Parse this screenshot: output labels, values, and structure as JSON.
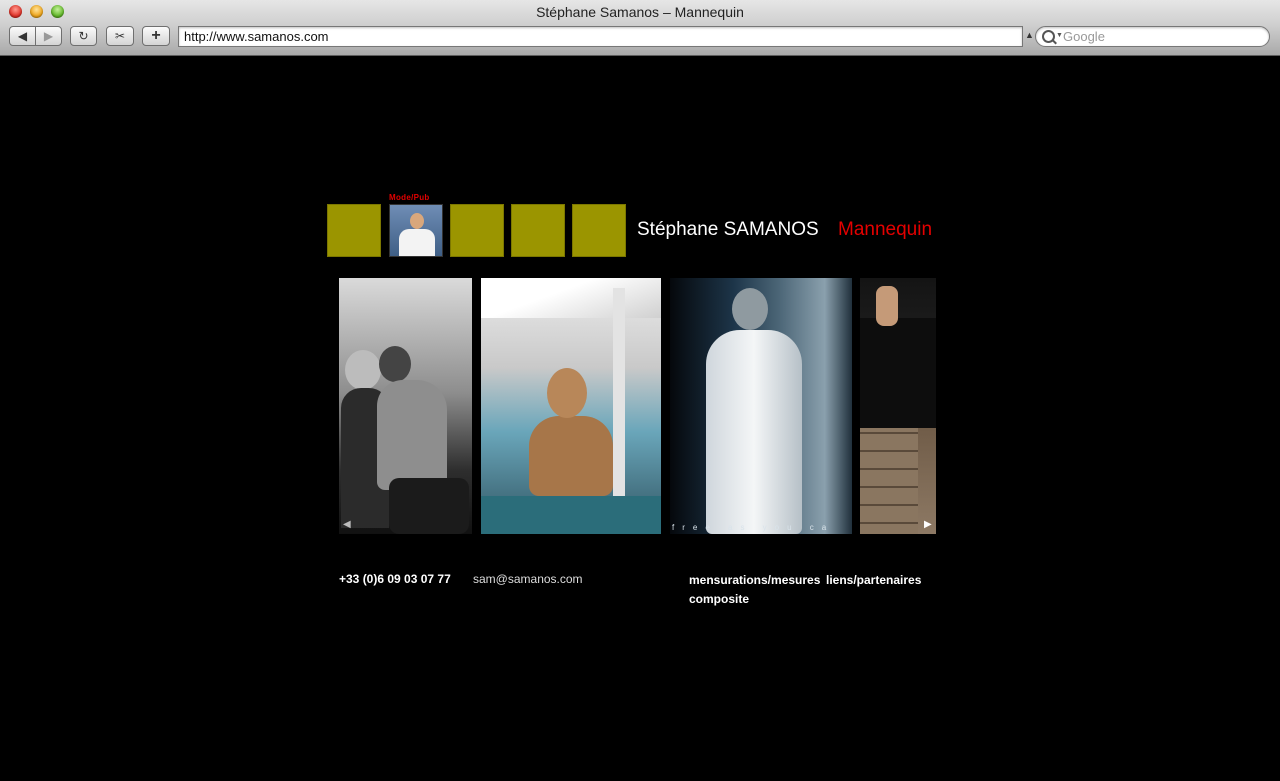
{
  "window": {
    "title": "Stéphane Samanos – Mannequin",
    "url": "http://www.samanos.com",
    "search_placeholder": "Google"
  },
  "toolbar": {
    "back_glyph": "◀",
    "forward_glyph": "▶",
    "reload_glyph": "↻",
    "snip_glyph": "✂",
    "add_glyph": "+",
    "url_menu_glyph": "▲▼"
  },
  "header": {
    "active_tile_label": "Mode/Pub",
    "name": "Stéphane SAMANOS",
    "role": "Mannequin"
  },
  "gallery": {
    "photo3_caption": "free as you ca",
    "prev_arrow": "◀",
    "next_arrow": "▶"
  },
  "footer": {
    "phone": "+33 (0)6 09 03 07 77",
    "email": "sam@samanos.com",
    "links": {
      "measurements": "mensurations/mesures",
      "partners": "liens/partenaires",
      "composite": "composite"
    }
  },
  "colors": {
    "tile": "#9b9500",
    "accent_red": "#e50000",
    "background": "#000000"
  }
}
